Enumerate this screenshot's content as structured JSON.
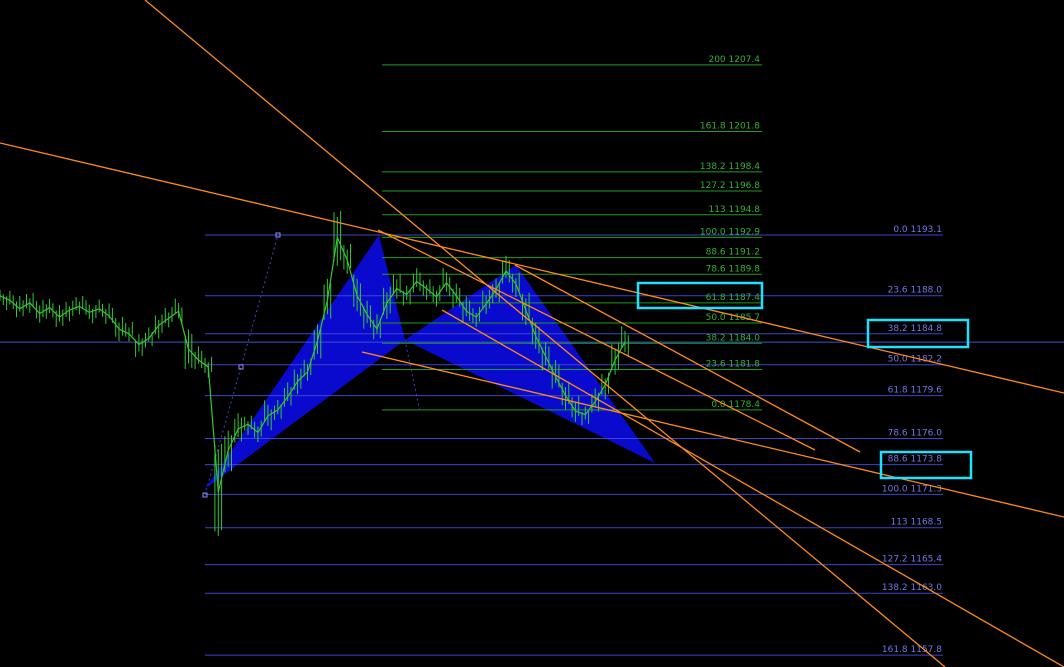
{
  "colors": {
    "background": "#000000",
    "fib_green": "#1f9b1f",
    "fib_green_text": "#35b035",
    "fib_blue": "#3b46c8",
    "fib_blue_text": "#6f78e8",
    "pattern_fill": "#0b0bd9",
    "price_bars": "#32c832",
    "trendlines": "#ff8a1a",
    "highlight_boxes": "#20e0ff",
    "current_price_line": "#3a4fd0"
  },
  "chart_data": {
    "type": "line",
    "title": "",
    "xlabel": "",
    "ylabel": "",
    "ylim": [
      1155,
      1210
    ],
    "series": [
      {
        "values": [
          1188.0,
          1187.6,
          1186.9,
          1187.4,
          1186.5,
          1187.0,
          1186.2,
          1186.8,
          1187.1,
          1186.6,
          1186.9,
          1186.3,
          1185.2,
          1184.8,
          1183.9,
          1184.4,
          1185.5,
          1186.1,
          1186.7,
          1183.5,
          1182.6,
          1182.0,
          1171.5,
          1175.0,
          1176.8,
          1177.2,
          1176.5,
          1177.9,
          1178.4,
          1179.5,
          1180.8,
          1181.6,
          1184.2,
          1187.6,
          1192.9,
          1191.0,
          1188.0,
          1186.4,
          1185.2,
          1187.4,
          1188.6,
          1188.1,
          1189.2,
          1188.6,
          1187.9,
          1189.1,
          1188.0,
          1186.7,
          1186.2,
          1187.3,
          1188.5,
          1190.1,
          1189.0,
          1186.8,
          1184.6,
          1182.9,
          1181.2,
          1179.6,
          1178.3,
          1178.0,
          1179.1,
          1180.5,
          1182.6,
          1184.1
        ]
      }
    ]
  },
  "fib_green": {
    "levels": [
      {
        "label": "200 1207.4",
        "price": 1207.4
      },
      {
        "label": "161.8 1201.8",
        "price": 1201.8
      },
      {
        "label": "138.2 1198.4",
        "price": 1198.4
      },
      {
        "label": "127.2 1196.8",
        "price": 1196.8
      },
      {
        "label": "113 1194.8",
        "price": 1194.8
      },
      {
        "label": "100.0 1192.9",
        "price": 1192.9
      },
      {
        "label": "88.6 1191.2",
        "price": 1191.2
      },
      {
        "label": "78.6 1189.8",
        "price": 1189.8
      },
      {
        "label": "61.8 1187.4",
        "price": 1187.4
      },
      {
        "label": "50.0 1185.7",
        "price": 1185.7
      },
      {
        "label": "38.2 1184.0",
        "price": 1184.0
      },
      {
        "label": "23.6 1181.8",
        "price": 1181.8
      },
      {
        "label": "0.0 1178.4",
        "price": 1178.4
      }
    ]
  },
  "fib_blue": {
    "levels": [
      {
        "label": "0.0 1193.1",
        "price": 1193.1
      },
      {
        "label": "23.6 1188.0",
        "price": 1188.0
      },
      {
        "label": "38.2 1184.8",
        "price": 1184.8
      },
      {
        "label": "50.0 1182.2",
        "price": 1182.2
      },
      {
        "label": "61.8 1179.6",
        "price": 1179.6
      },
      {
        "label": "78.6 1176.0",
        "price": 1176.0
      },
      {
        "label": "88.6 1173.8",
        "price": 1173.8
      },
      {
        "label": "100.0 1171.3",
        "price": 1171.3
      },
      {
        "label": "113 1168.5",
        "price": 1168.5
      },
      {
        "label": "127.2 1165.4",
        "price": 1165.4
      },
      {
        "label": "138.2 1163.0",
        "price": 1163.0
      },
      {
        "label": "161.8 1157.8",
        "price": 1157.8
      }
    ]
  },
  "current_price": 1184.1,
  "highlights": [
    "61.8 1187.4",
    "38.2 1184.8",
    "88.6 1173.8"
  ]
}
